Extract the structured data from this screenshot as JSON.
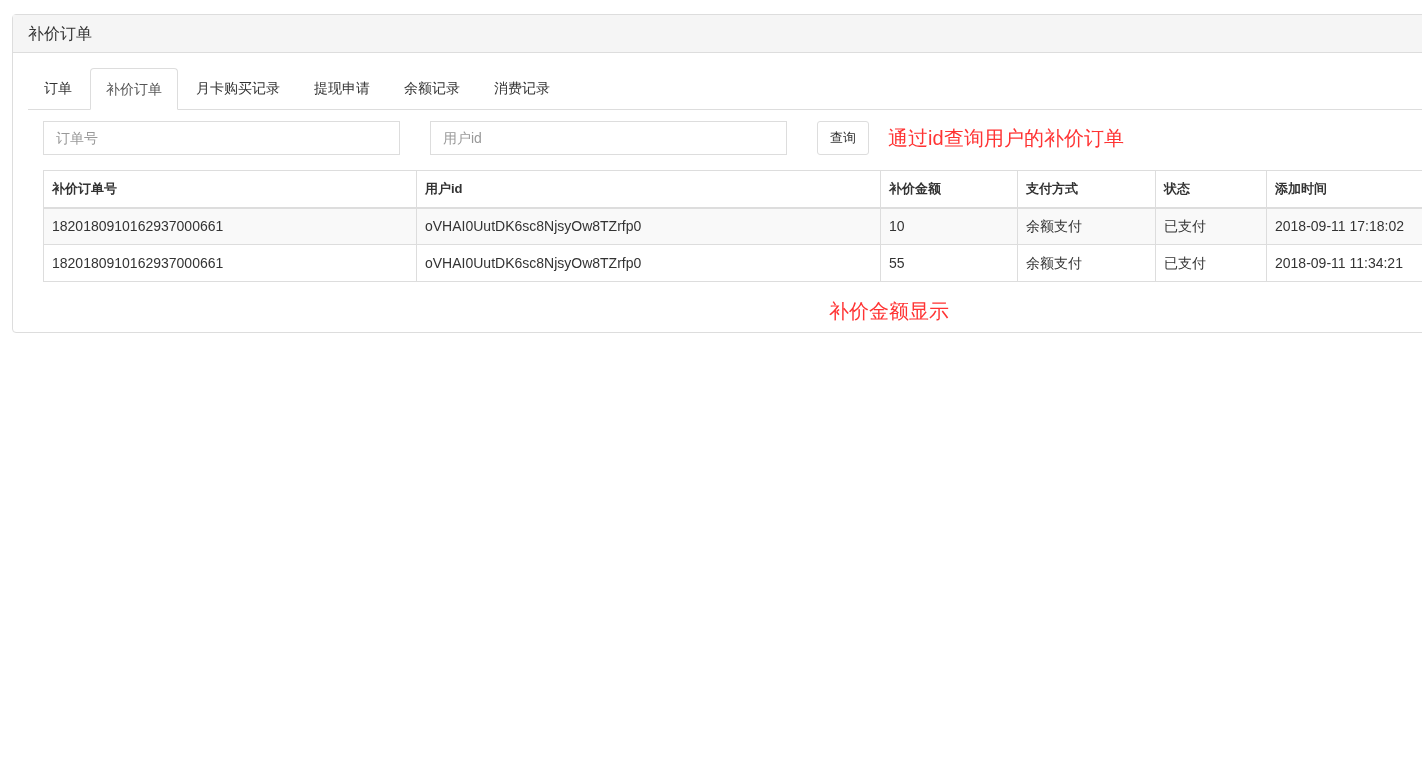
{
  "panel": {
    "title": "补价订单"
  },
  "tabs": [
    {
      "label": "订单",
      "selected": false
    },
    {
      "label": "补价订单",
      "selected": true
    },
    {
      "label": "月卡购买记录",
      "selected": false
    },
    {
      "label": "提现申请",
      "selected": false
    },
    {
      "label": "余额记录",
      "selected": false
    },
    {
      "label": "消费记录",
      "selected": false
    }
  ],
  "search": {
    "fields": [
      {
        "placeholder": "订单号"
      },
      {
        "placeholder": "用户id"
      }
    ],
    "button": "查询",
    "annotation": "通过id查询用户的补价订单"
  },
  "table": {
    "columns": [
      "补价订单号",
      "用户id",
      "补价金额",
      "支付方式",
      "状态",
      "添加时间"
    ],
    "rows": [
      [
        "1820180910162937000661",
        "oVHAI0UutDK6sc8NjsyOw8TZrfp0",
        "10",
        "余额支付",
        "已支付",
        "2018-09-11 17:18:02"
      ],
      [
        "1820180910162937000661",
        "oVHAI0UutDK6sc8NjsyOw8TZrfp0",
        "55",
        "余额支付",
        "已支付",
        "2018-09-11 11:34:21"
      ]
    ]
  },
  "annotation": "补价金额显示"
}
